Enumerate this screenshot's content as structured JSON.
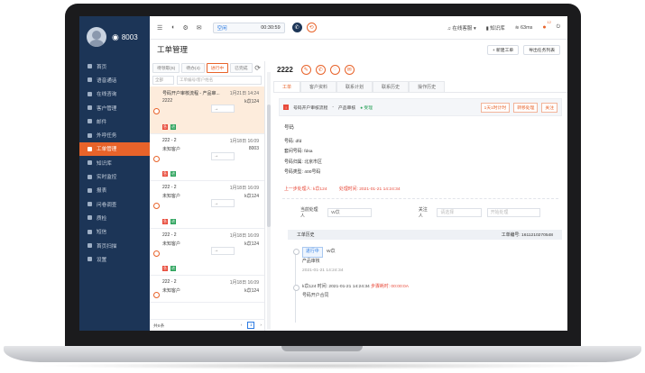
{
  "sidebar": {
    "extension": "8003",
    "items": [
      {
        "label": "首页"
      },
      {
        "label": "语音通话"
      },
      {
        "label": "在线咨询"
      },
      {
        "label": "客户管理"
      },
      {
        "label": "邮件"
      },
      {
        "label": "外呼任务"
      },
      {
        "label": "工单管理"
      },
      {
        "label": "知识库"
      },
      {
        "label": "实时监控"
      },
      {
        "label": "报表"
      },
      {
        "label": "问卷调查"
      },
      {
        "label": "质检"
      },
      {
        "label": "短信"
      },
      {
        "label": "首页扫描"
      },
      {
        "label": "设置"
      }
    ],
    "active_index": 6
  },
  "topbar": {
    "status": "空闲",
    "timer": "00:30:59",
    "online_status": "在线客服",
    "kb": "知识库",
    "latency": "63ms",
    "bell_count": "12"
  },
  "page": {
    "title": "工单管理",
    "new_button": "+ 新建工单",
    "export_button": "导出任务列表"
  },
  "list": {
    "tabs": [
      "待领取(6)",
      "待办(4)",
      "进行中",
      "已完成"
    ],
    "active_tab": 2,
    "filter_select": "全部",
    "search_placeholder": "工单编号/客户姓名",
    "cards": [
      {
        "name": "号码开户审核流程 - 产品审...",
        "time": "1月21日 14:24",
        "num": "2222",
        "owner": "k苡124",
        "arrow": "→"
      },
      {
        "name": "222 - 2",
        "time": "1月18日 16:09",
        "num": "未知客户",
        "owner": "8003",
        "arrow": "→"
      },
      {
        "name": "222 - 2",
        "time": "1月18日 16:09",
        "num": "未知客户",
        "owner": "k苡124",
        "arrow": "→"
      },
      {
        "name": "222 - 2",
        "time": "1月18日 16:09",
        "num": "未知客户",
        "owner": "k苡124",
        "arrow": "→"
      },
      {
        "name": "222 - 2",
        "time": "1月18日 16:09",
        "num": "未知客户",
        "owner": "k苡124",
        "arrow": "→"
      },
      {
        "name": "222 - 2",
        "time": "1月18日 16:09",
        "num": "未知客户",
        "owner": "",
        "arrow": ""
      }
    ],
    "pager_label": "共8条",
    "current_page": "1"
  },
  "detail": {
    "number": "2222",
    "tabs": [
      "工单",
      "客户资料",
      "联系计划",
      "联系历史",
      "操作历史"
    ],
    "active_tab": 0,
    "flow_name": "号码开户审核流程",
    "node_name": "产品审核",
    "state": "● 受理",
    "actions": [
      "1天1时计时",
      "转移处理",
      "关注"
    ],
    "fields": {
      "number_line": "号码",
      "f1": "号码:  dfd",
      "f2": "套间号码:  fdsa",
      "f3": "号码归属:  北京市区",
      "f4": "号码类型:  400号码"
    },
    "prev_handler": "上一步处理人:  k苡124",
    "prev_time": "处理时间:  2021-01-21 14:24:34",
    "assign_label": "当前处理人",
    "assign_value": "W苡",
    "follow_label": "关注人",
    "follow_placeholder": "请选择",
    "start_placeholder": "开始处理",
    "history_title": "工单历史",
    "history_id": "工单编号: 1611210270548",
    "timeline": [
      {
        "badge": "进行中",
        "who": "W苡",
        "what": "产品审核",
        "time": "2021-01-21 14:24:34"
      },
      {
        "who": "k苡124",
        "when": "时间:  2021-01-21 14:24:34",
        "duration": "步骤耗时:  00:00:0A",
        "what": "号码开户合同"
      }
    ]
  }
}
